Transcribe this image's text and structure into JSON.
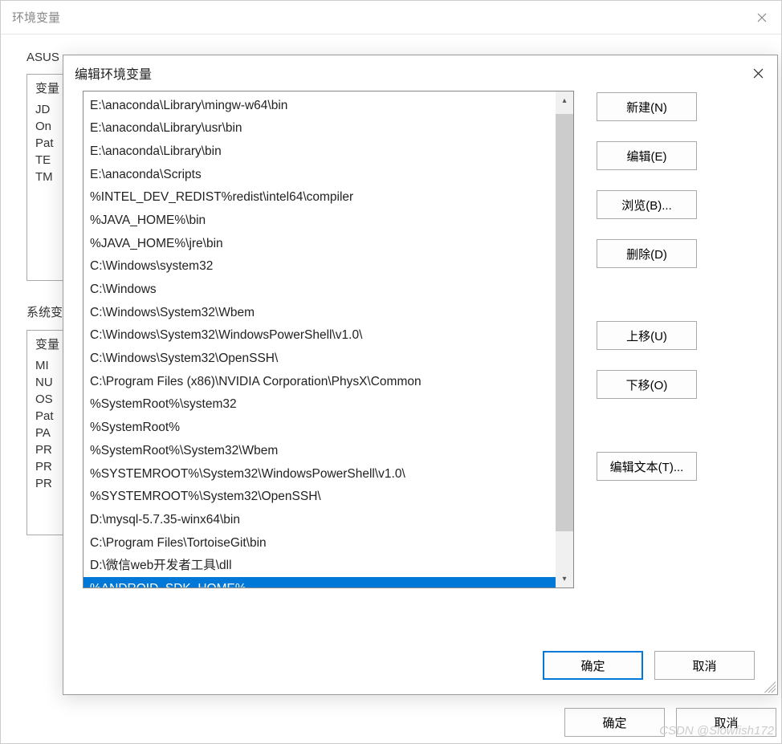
{
  "bg": {
    "title": "环境变量",
    "user_section": "ASUS",
    "sys_section": "系统变",
    "var_header": "变量",
    "user_rows": [
      "JD",
      "On",
      "Pat",
      "TE",
      "TM"
    ],
    "sys_rows": [
      "MI",
      "NU",
      "OS",
      "Pat",
      "PA",
      "PR",
      "PR",
      "PR"
    ],
    "footer_ok": "确定",
    "footer_cancel": "取消"
  },
  "modal": {
    "title": "编辑环境变量",
    "paths": [
      "E:\\anaconda\\Library\\mingw-w64\\bin",
      "E:\\anaconda\\Library\\usr\\bin",
      "E:\\anaconda\\Library\\bin",
      "E:\\anaconda\\Scripts",
      "%INTEL_DEV_REDIST%redist\\intel64\\compiler",
      "%JAVA_HOME%\\bin",
      "%JAVA_HOME%\\jre\\bin",
      "C:\\Windows\\system32",
      "C:\\Windows",
      "C:\\Windows\\System32\\Wbem",
      "C:\\Windows\\System32\\WindowsPowerShell\\v1.0\\",
      "C:\\Windows\\System32\\OpenSSH\\",
      "C:\\Program Files (x86)\\NVIDIA Corporation\\PhysX\\Common",
      "%SystemRoot%\\system32",
      "%SystemRoot%",
      "%SystemRoot%\\System32\\Wbem",
      "%SYSTEMROOT%\\System32\\WindowsPowerShell\\v1.0\\",
      "%SYSTEMROOT%\\System32\\OpenSSH\\",
      "D:\\mysql-5.7.35-winx64\\bin",
      "C:\\Program Files\\TortoiseGit\\bin",
      "D:\\微信web开发者工具\\dll",
      "%ANDROID_SDK_HOME%"
    ],
    "selected_index": 21,
    "buttons": {
      "new": "新建(N)",
      "edit": "编辑(E)",
      "browse": "浏览(B)...",
      "delete": "删除(D)",
      "moveup": "上移(U)",
      "movedown": "下移(O)",
      "edittext": "编辑文本(T)...",
      "ok": "确定",
      "cancel": "取消"
    }
  },
  "watermark": "CSDN @Slowfish172"
}
